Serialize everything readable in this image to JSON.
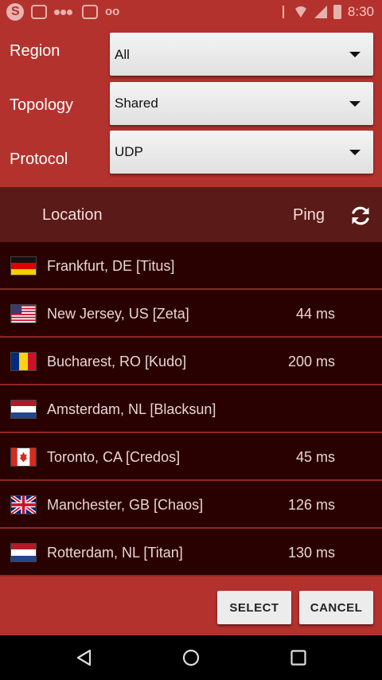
{
  "status_bar": {
    "time": "8:30",
    "icons": [
      "skype-icon",
      "screen-icon",
      "people-icon",
      "image-icon",
      "voicemail-icon",
      "bluetooth-icon",
      "wifi-icon",
      "signal-icon",
      "battery-icon"
    ]
  },
  "settings": {
    "region": {
      "label": "Region",
      "value": "All"
    },
    "topology": {
      "label": "Topology",
      "value": "Shared"
    },
    "protocol": {
      "label": "Protocol",
      "value": "UDP"
    }
  },
  "list_header": {
    "location_label": "Location",
    "ping_label": "Ping",
    "refresh_icon": "refresh-icon"
  },
  "servers": [
    {
      "name": "Frankfurt, DE [Titus]",
      "ping": "",
      "flag": "DE"
    },
    {
      "name": "New Jersey, US [Zeta]",
      "ping": "44 ms",
      "flag": "US"
    },
    {
      "name": "Bucharest, RO [Kudo]",
      "ping": "200 ms",
      "flag": "RO"
    },
    {
      "name": "Amsterdam, NL [Blacksun]",
      "ping": "",
      "flag": "NL"
    },
    {
      "name": "Toronto, CA [Credos]",
      "ping": "45 ms",
      "flag": "CA"
    },
    {
      "name": "Manchester, GB [Chaos]",
      "ping": "126 ms",
      "flag": "GB"
    },
    {
      "name": "Rotterdam, NL [Titan]",
      "ping": "130 ms",
      "flag": "NL"
    }
  ],
  "buttons": {
    "select": "SELECT",
    "cancel": "CANCEL"
  },
  "colors": {
    "accent": "#b4322d",
    "header": "#5a1a17",
    "list_bg": "#2a0101",
    "divider": "#8d2724"
  }
}
